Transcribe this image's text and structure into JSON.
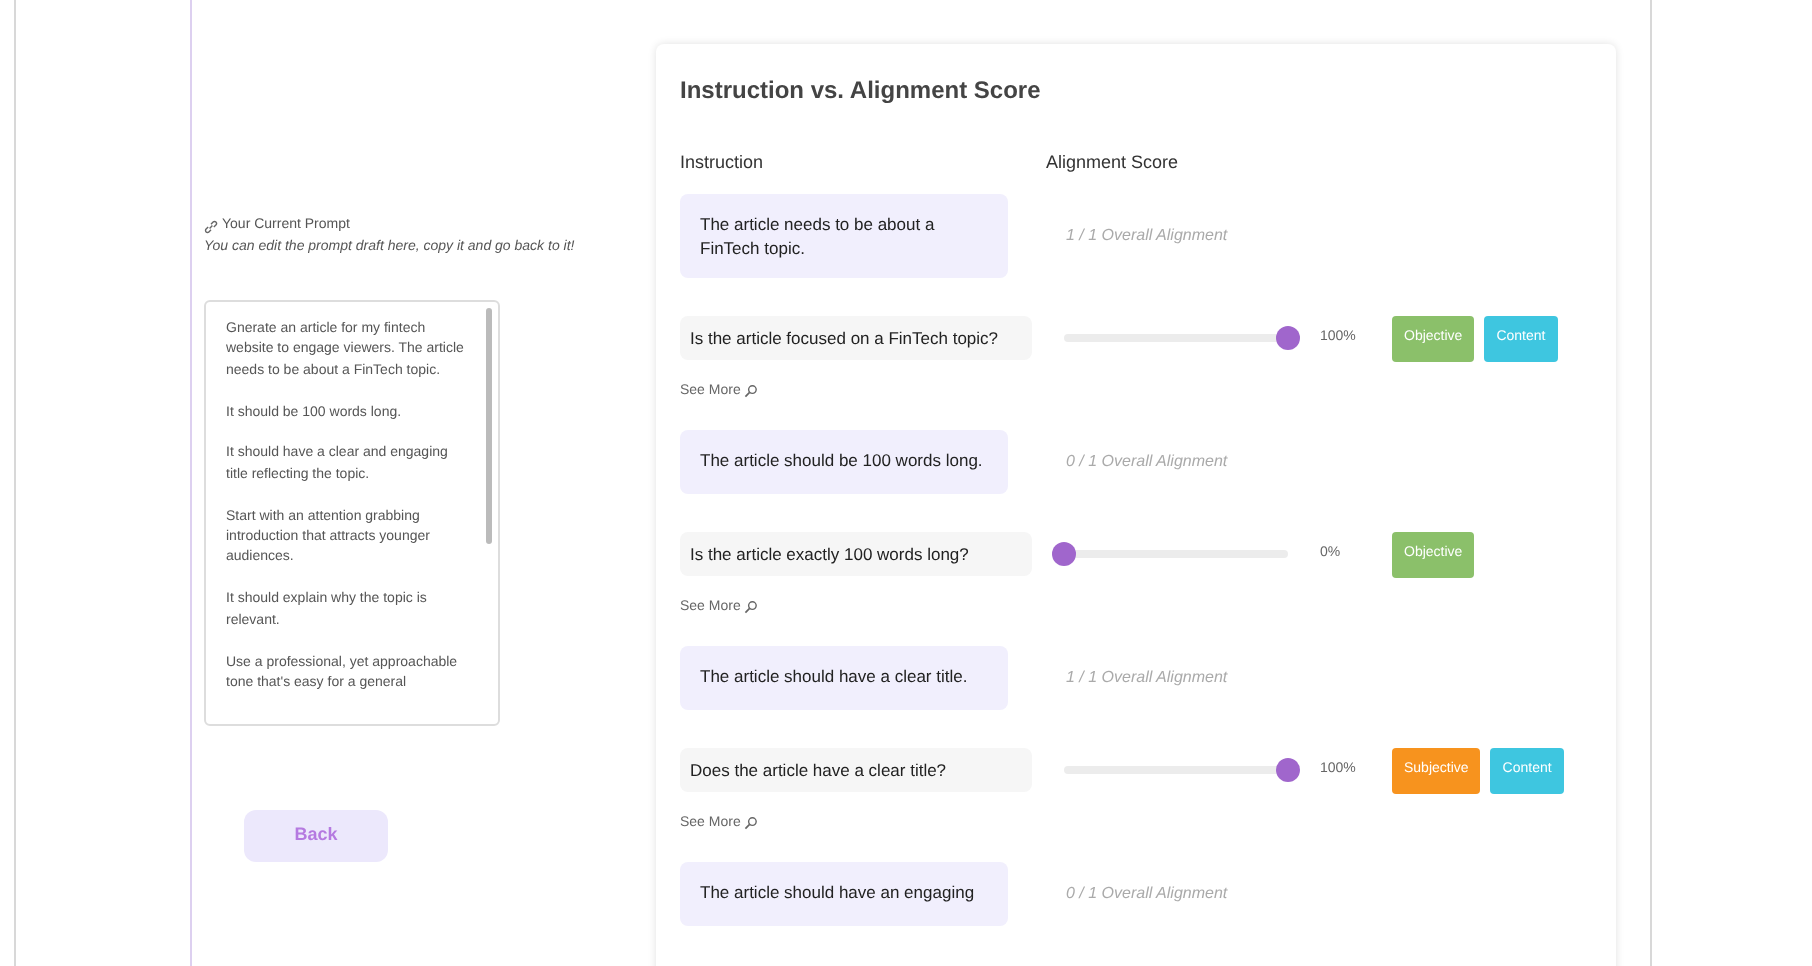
{
  "prompt_panel": {
    "label": "Your Current Prompt",
    "hint": "You can edit the prompt draft here, copy it and go back to it!",
    "value": "Gnerate an article for my fintech website to engage viewers. The article needs to be about a FinTech topic.\n\nIt should be 100 words long.\n\nIt should have a clear and engaging title reflecting the topic.\n\nStart with an attention grabbing introduction that attracts younger audiences.\n\nIt should explain why the topic is relevant.\n\nUse a professional, yet approachable tone that's easy for a general",
    "back_button": "Back"
  },
  "score_card": {
    "title": "Instruction vs. Alignment Score",
    "columns": [
      "Instruction",
      "Alignment Score"
    ],
    "groups": [
      {
        "instruction": "The article needs to be about a FinTech topic.",
        "overall": "1 / 1 Overall Alignment",
        "questions": [
          {
            "text": "Is the article focused on a FinTech topic?",
            "level": 1,
            "reading": "100%",
            "tags": [
              {
                "label": "Objective",
                "kind": "objective"
              },
              {
                "label": "Content",
                "kind": "content"
              }
            ],
            "see_more": "See More"
          }
        ]
      },
      {
        "instruction": "The article should be 100 words long.",
        "overall": "0 / 1 Overall Alignment",
        "questions": [
          {
            "text": "Is the article exactly 100 words long?",
            "level": 0,
            "reading": "0%",
            "tags": [
              {
                "label": "Objective",
                "kind": "objective"
              }
            ],
            "see_more": "See More"
          }
        ]
      },
      {
        "instruction": "The article should have a clear title.",
        "overall": "1 / 1 Overall Alignment",
        "questions": [
          {
            "text": "Does the article have a clear title?",
            "level": 1,
            "reading": "100%",
            "tags": [
              {
                "label": "Subjective",
                "kind": "subjective"
              },
              {
                "label": "Content",
                "kind": "content"
              }
            ],
            "see_more": "See More"
          }
        ]
      },
      {
        "instruction": "The article should have an engaging",
        "overall": "0 / 1 Overall Alignment"
      }
    ]
  }
}
